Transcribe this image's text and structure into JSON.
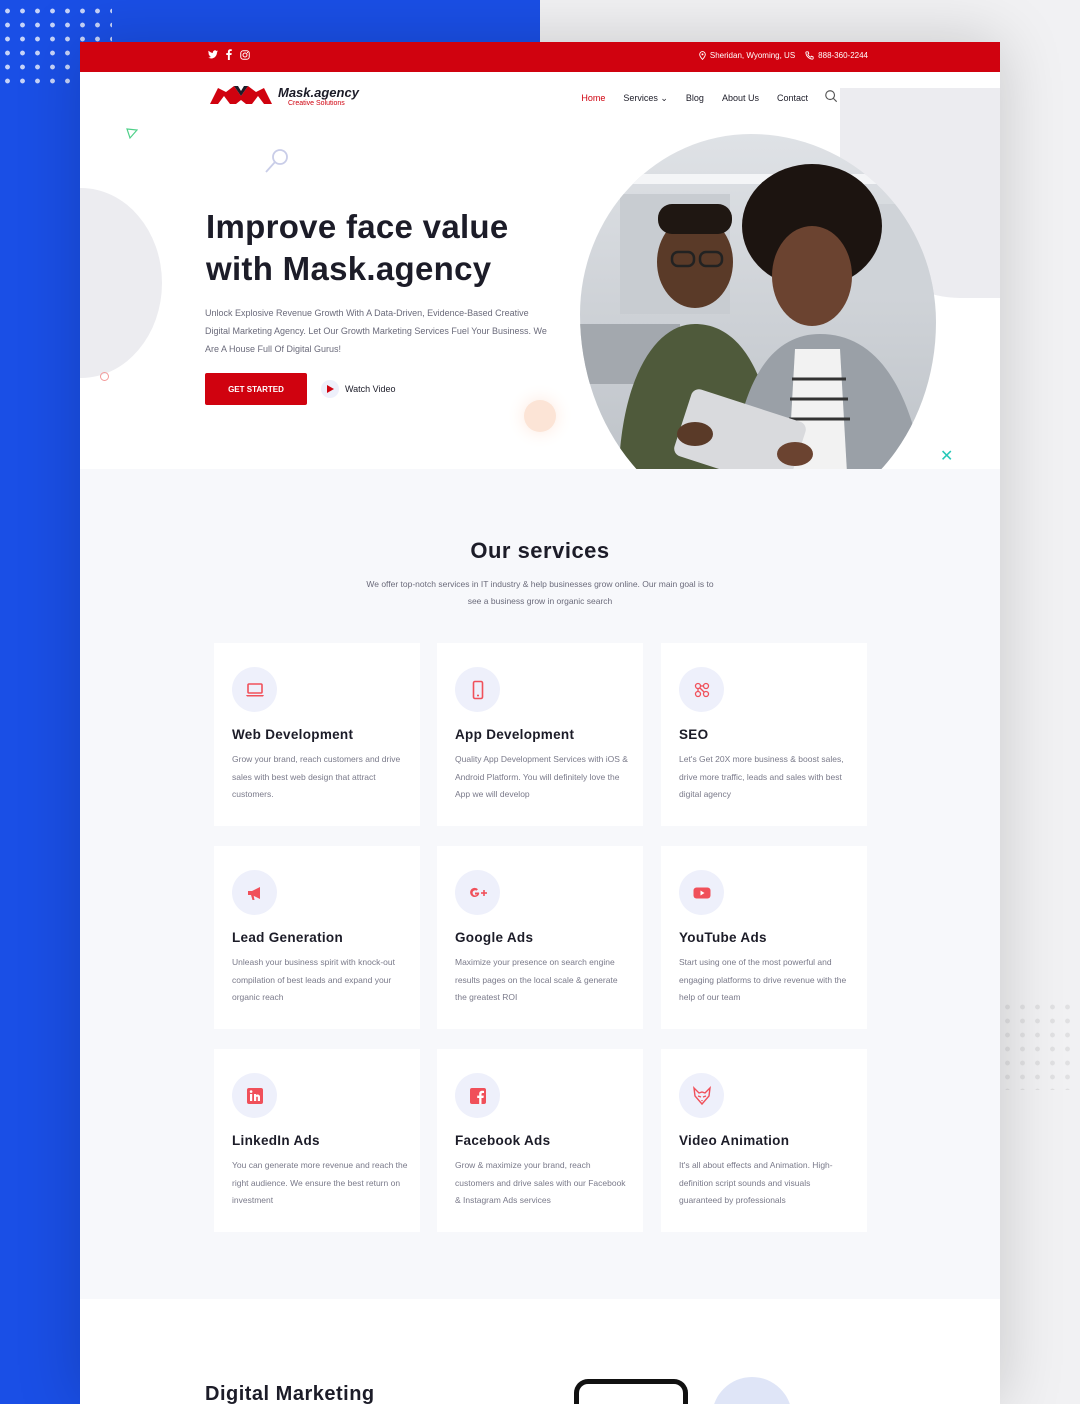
{
  "topbar": {
    "social": [
      {
        "icon": "twitter-icon",
        "glyph": "𝕥"
      },
      {
        "icon": "facebook-icon",
        "glyph": "f"
      },
      {
        "icon": "instagram-icon",
        "glyph": "◎"
      }
    ],
    "location": "Sheridan, Wyoming, US",
    "phone": "888-360-2244"
  },
  "logo": {
    "name": "Mask.agency",
    "tagline": "Creative Solutions"
  },
  "nav": {
    "items": [
      {
        "label": "Home",
        "active": true
      },
      {
        "label": "Services ⌄",
        "active": false
      },
      {
        "label": "Blog",
        "active": false
      },
      {
        "label": "About Us",
        "active": false
      },
      {
        "label": "Contact",
        "active": false
      }
    ]
  },
  "hero": {
    "title": "Improve face value with Mask.agency",
    "description": "Unlock Explosive Revenue Growth With A Data-Driven, Evidence-Based Creative Digital Marketing Agency. Let Our Growth Marketing Services Fuel Your Business. We Are A House Full Of Digital Gurus!",
    "cta_label": "GET STARTED",
    "video_label": "Watch Video"
  },
  "services": {
    "title": "Our services",
    "lead": "We offer top-notch services in IT industry & help businesses grow online. Our main goal is to see a business grow in organic search",
    "cards": [
      {
        "icon": "laptop-icon",
        "title": "Web Development",
        "text": "Grow your brand, reach customers and drive sales with best web design that attract customers."
      },
      {
        "icon": "mobile-icon",
        "title": "App Development",
        "text": "Quality App Development Services with iOS & Android Platform. You will definitely love the App we will develop"
      },
      {
        "icon": "seo-icon",
        "title": "SEO",
        "text": "Let's Get 20X more business & boost sales, drive more traffic, leads and sales with best digital agency"
      },
      {
        "icon": "megaphone-icon",
        "title": "Lead Generation",
        "text": "Unleash your business spirit with knock-out compilation of best leads and expand your organic reach"
      },
      {
        "icon": "google-plus-icon",
        "title": "Google Ads",
        "text": "Maximize your presence on search engine results pages on the local scale & generate the greatest ROI"
      },
      {
        "icon": "youtube-icon",
        "title": "YouTube Ads",
        "text": "Start using one of the most powerful and engaging platforms to drive revenue with the help of our team"
      },
      {
        "icon": "linkedin-icon",
        "title": "LinkedIn Ads",
        "text": "You can generate more revenue and reach the right audience. We ensure the best return on investment"
      },
      {
        "icon": "facebook-icon",
        "title": "Facebook Ads",
        "text": "Grow & maximize your brand, reach customers and drive sales with our Facebook & Instagram Ads services"
      },
      {
        "icon": "fox-mask-icon",
        "title": "Video Animation",
        "text": "It's all about effects and Animation. High-definition script sounds and visuals guaranteed by professionals"
      }
    ]
  },
  "digital": {
    "title": "Digital Marketing"
  },
  "colors": {
    "brand_red": "#d0020f",
    "backdrop_blue": "#1a4fe6",
    "icon_bg": "#eef0fb",
    "icon_red": "#f0505a"
  }
}
